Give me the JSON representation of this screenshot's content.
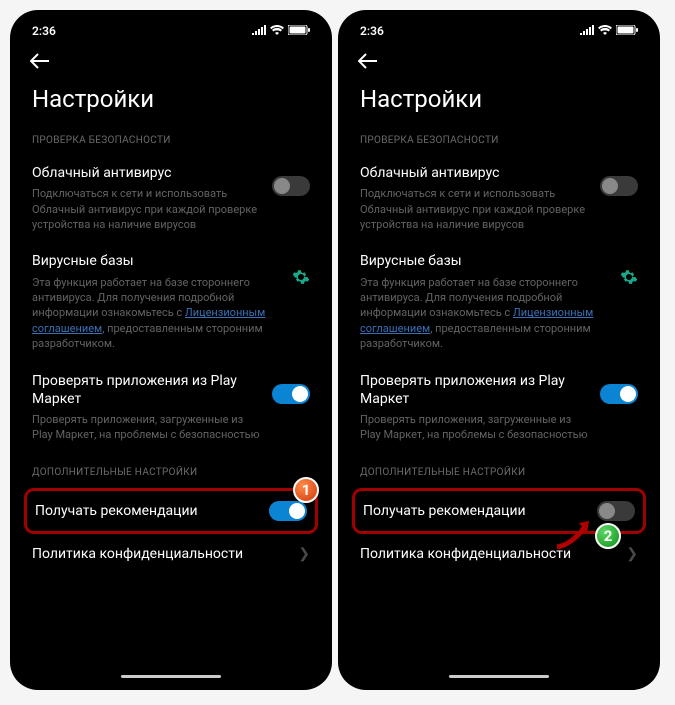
{
  "status": {
    "time": "2:36"
  },
  "header": {
    "title": "Настройки"
  },
  "sections": {
    "security": "ПРОВЕРКА БЕЗОПАСНОСТИ",
    "additional": "ДОПОЛНИТЕЛЬНЫЕ НАСТРОЙКИ"
  },
  "items": {
    "cloud_av": {
      "title": "Облачный антивирус",
      "desc": "Подключаться к сети и использовать Облачный антивирус при каждой проверке устройства на наличие вирусов"
    },
    "virus_db": {
      "title": "Вирусные базы",
      "desc_pre": "Эта функция работает на базе стороннего антивируса. Для получения подробной информации ознакомьтесь с ",
      "desc_link": "Лицензионным соглашением",
      "desc_post": ", предоставленным сторонним разработчиком."
    },
    "play_check": {
      "title": "Проверять приложения из Play Маркет",
      "desc": "Проверять приложения, загруженные из Play Маркет, на проблемы с безопасностью"
    },
    "recommendations": {
      "title": "Получать рекомендации"
    },
    "privacy": {
      "title": "Политика конфиденциальности"
    }
  },
  "badges": {
    "one": "1",
    "two": "2"
  }
}
